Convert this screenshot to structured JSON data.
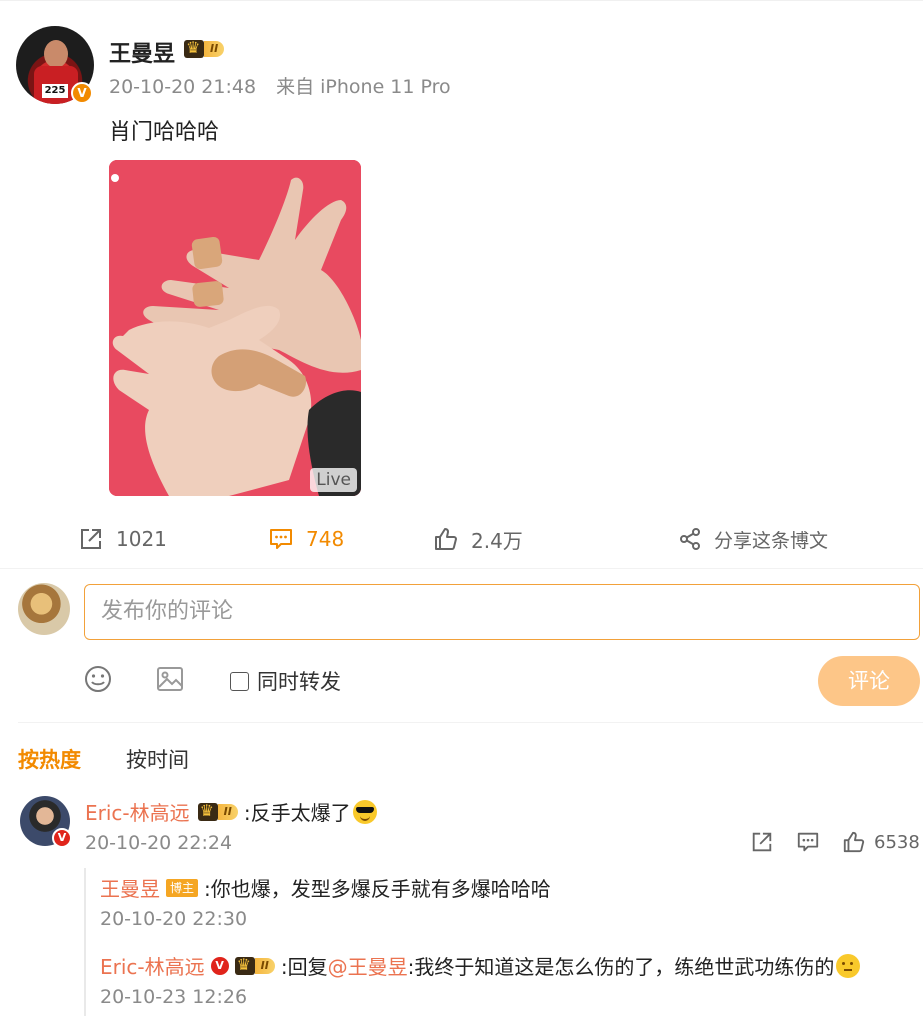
{
  "post": {
    "author": "王曼昱",
    "level": "II",
    "time": "20-10-20 21:48",
    "source": "来自 iPhone 11 Pro",
    "text": "肖门哈哈哈",
    "avatar_number": "225",
    "verified_mark": "V",
    "live_tag": "Live"
  },
  "actions": {
    "repost_count": "1021",
    "comment_count": "748",
    "like_count": "2.4万",
    "share_label": "分享这条博文"
  },
  "composer": {
    "placeholder": "发布你的评论",
    "forward_label": "同时转发",
    "submit_label": "评论"
  },
  "sort": {
    "hot": "按热度",
    "time": "按时间"
  },
  "comment": {
    "user": "Eric-林高远",
    "level": "II",
    "text": ":反手太爆了",
    "time": "20-10-20 22:24",
    "like_count": "6538",
    "verified_mark": "V"
  },
  "replies": [
    {
      "user": "王曼昱",
      "tag": "博主",
      "text": ":你也爆，发型多爆反手就有多爆哈哈哈",
      "time": "20-10-20 22:30"
    },
    {
      "user": "Eric-林高远",
      "level": "II",
      "prefix": ":回复",
      "mention": "@王曼昱",
      "text": ":我终于知道这是怎么伤的了，练绝世武功练伤的",
      "time": "20-10-23 12:26",
      "verified_mark": "V"
    }
  ],
  "colors": {
    "accent": "#f28a00",
    "username": "#eb7350",
    "input_border": "#f2a13a",
    "submit_bg": "#fdc688"
  },
  "icons": [
    "repost-icon",
    "comment-icon",
    "like-icon",
    "share-icon",
    "emoji-icon",
    "image-icon",
    "crown-icon",
    "verified-icon"
  ]
}
